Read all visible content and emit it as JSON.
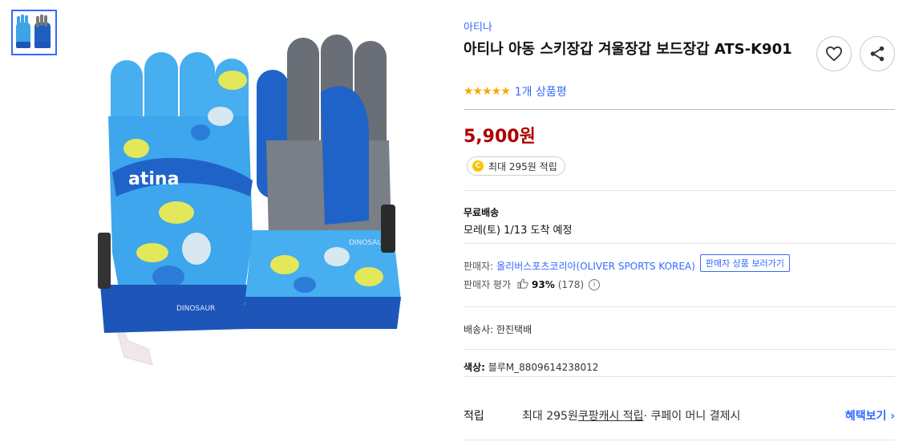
{
  "gallery": {
    "thumbnail_alt": "glove thumbnail",
    "image_brand_text": "atina",
    "print_text_left": "DINOSAUR",
    "print_text_right": "DINOSAUR"
  },
  "product": {
    "brand": "아티나",
    "title": "아티나 아동 스키장갑 겨울장갑 보드장갑 ATS-K901",
    "rating_stars": 5,
    "review_link": "1개 상품평",
    "price": "5,900원",
    "reward_chip": "최대 295원 적립",
    "coin_letter": "C"
  },
  "shipping": {
    "label": "무료배송",
    "arrival": "모레(토) 1/13 도착 예정"
  },
  "seller": {
    "label": "판매자:",
    "name": "올리버스포츠코리아(OLIVER SPORTS KOREA)",
    "products_button": "판매자 상품 보러가기",
    "rating_label": "판매자 평가",
    "rating_score": "93%",
    "rating_count": "(178)"
  },
  "courier": "배송사: 한진택배",
  "color": {
    "label": "색상:",
    "value": "블루M_8809614238012"
  },
  "reward": {
    "label": "적립",
    "text_prefix": "최대 295원 ",
    "text_underline": "쿠팡캐시 적립",
    "text_suffix": " · 쿠페이 머니 결제시",
    "benefit_link": "혜택보기 ›"
  },
  "colors": {
    "accent": "#346aff",
    "price": "#ae0000",
    "star": "#f5a800",
    "glove_blue": "#1e6fd0"
  }
}
